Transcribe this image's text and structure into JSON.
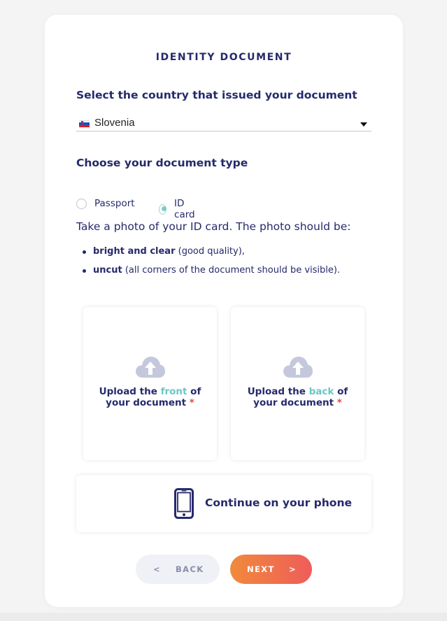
{
  "card": {
    "title": "IDENTITY DOCUMENT"
  },
  "country": {
    "label": "Select the country that issued your document",
    "value": "Slovenia",
    "flag_icon": "slovenia-flag-icon"
  },
  "document_type": {
    "label": "Choose your document type",
    "options": [
      {
        "label": "Passport",
        "selected": false
      },
      {
        "label": "ID card",
        "selected": true
      }
    ]
  },
  "instructions": {
    "intro": "Take a photo of your ID card. The photo should be:",
    "bullets": [
      {
        "bold": "bright and clear",
        "rest": " (good quality),"
      },
      {
        "bold": "uncut",
        "rest": " (all corners of the document should be visible)."
      }
    ]
  },
  "uploads": {
    "front": {
      "prefix": "Upload the ",
      "highlight": "front",
      "suffix": " of",
      "line2": "your document",
      "required": "*"
    },
    "back": {
      "prefix": "Upload the ",
      "highlight": "back",
      "suffix": " of",
      "line2": "your document",
      "required": "*"
    }
  },
  "phone": {
    "label": "Continue on your phone"
  },
  "nav": {
    "back_chevron": "<",
    "back_label": "BACK",
    "next_label": "NEXT",
    "next_chevron": ">"
  },
  "colors": {
    "navy": "#252a6b",
    "teal": "#69c8c4",
    "required_red": "#e5474b",
    "next_gradient_start": "#f08a3c",
    "next_gradient_end": "#ef5c5a",
    "back_bg": "#f0f1f6",
    "cloud_icon": "#c5c8dd"
  }
}
